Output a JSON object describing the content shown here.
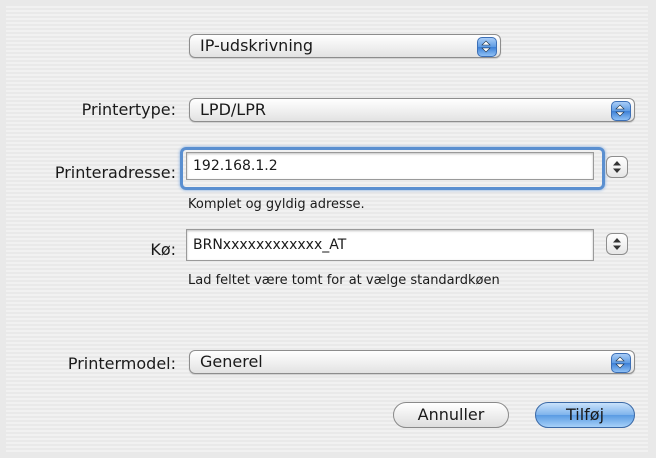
{
  "protocol_popup": {
    "value": "IP-udskrivning"
  },
  "printer_type": {
    "label": "Printertype:",
    "value": "LPD/LPR"
  },
  "printer_address": {
    "label": "Printeradresse:",
    "value": "192.168.1.2",
    "hint": "Komplet og gyldig adresse."
  },
  "queue": {
    "label": "Kø:",
    "value": "BRNxxxxxxxxxxxx_AT",
    "hint": "Lad feltet være tomt for at vælge standardkøen"
  },
  "printer_model": {
    "label": "Printermodel:",
    "value": "Generel"
  },
  "buttons": {
    "cancel": "Annuller",
    "add": "Tilføj"
  },
  "colors": {
    "accent": "#5a9be3",
    "focus": "#5a8fd0",
    "background": "#e9e9e9"
  }
}
